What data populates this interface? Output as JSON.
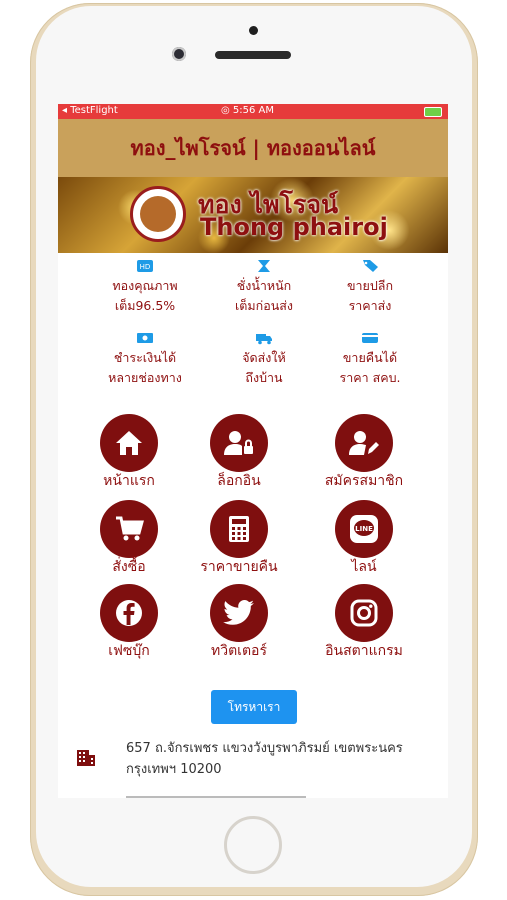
{
  "status_bar": {
    "app": "TestFlight",
    "time": "5:56 AM"
  },
  "header": {
    "title": "ทอง_ไพโรจน์ | ทองออนไลน์"
  },
  "banner": {
    "title_th": "ทอง ไพโรจน์",
    "title_en": "Thong phairoj"
  },
  "features": [
    {
      "icon": "certificate-icon",
      "line1": "ทองคุณภาพ",
      "line2": "เต็ม96.5%"
    },
    {
      "icon": "scale-icon",
      "line1": "ชั่งน้ำหนัก",
      "line2": "เต็มก่อนส่ง"
    },
    {
      "icon": "tag-icon",
      "line1": "ขายปลีก",
      "line2": "ราคาส่ง"
    },
    {
      "icon": "money-icon",
      "line1": "ชำระเงินได้",
      "line2": "หลายช่องทาง"
    },
    {
      "icon": "truck-icon",
      "line1": "จัดส่งให้",
      "line2": "ถึงบ้าน"
    },
    {
      "icon": "card-icon",
      "line1": "ขายคืนได้",
      "line2": "ราคา สคบ."
    }
  ],
  "menu": [
    {
      "icon": "home-icon",
      "label": "หน้าแรก"
    },
    {
      "icon": "user-lock-icon",
      "label": "ล็อกอิน"
    },
    {
      "icon": "user-edit-icon",
      "label": "สมัครสมาชิก"
    },
    {
      "icon": "cart-icon",
      "label": "สั่งซื้อ"
    },
    {
      "icon": "calculator-icon",
      "label": "ราคาขายคืน"
    },
    {
      "icon": "line-icon",
      "label": "ไลน์"
    },
    {
      "icon": "facebook-icon",
      "label": "เฟซบุ๊ก"
    },
    {
      "icon": "twitter-icon",
      "label": "ทวิตเตอร์"
    },
    {
      "icon": "instagram-icon",
      "label": "อินสตาแกรม"
    }
  ],
  "contact": {
    "button_label": "โทรหาเรา"
  },
  "address": {
    "line1": "657 ถ.จักรเพชร แขวงวังบูรพาภิรมย์ เขตพระนคร",
    "line2": "กรุงเทพฯ 10200"
  },
  "colors": {
    "brand": "#7f0f0f",
    "header_bg": "#c9a15b",
    "status_bar": "#e63b3b",
    "feature_icon": "#1e9be6",
    "button": "#1e93f0"
  }
}
